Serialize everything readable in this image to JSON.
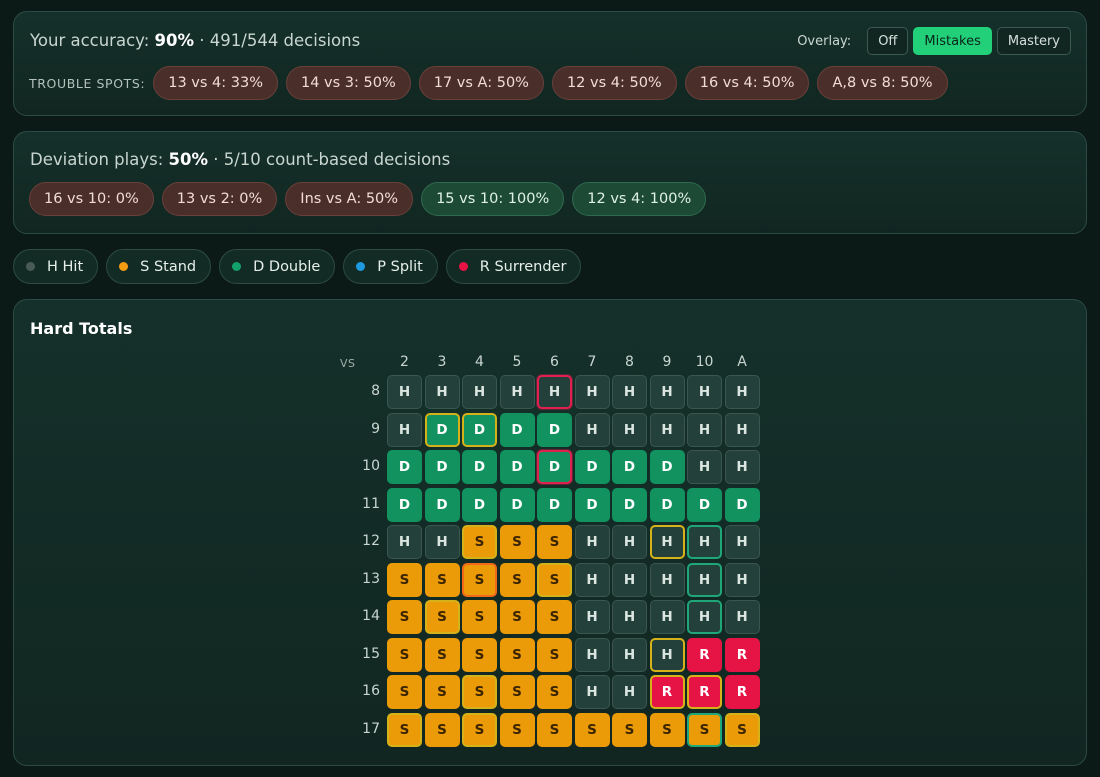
{
  "accuracy": {
    "prefix": "Your accuracy:",
    "percent": "90%",
    "detail": "· 491/544 decisions",
    "trouble_label": "TROUBLE SPOTS:",
    "trouble_spots": [
      "13 vs 4: 33%",
      "14 vs 3: 50%",
      "17 vs A: 50%",
      "12 vs 4: 50%",
      "16 vs 4: 50%",
      "A,8 vs 8: 50%"
    ]
  },
  "overlay": {
    "label": "Overlay:",
    "options": [
      "Off",
      "Mistakes",
      "Mastery"
    ],
    "selected": "Mistakes"
  },
  "deviation": {
    "prefix": "Deviation plays:",
    "percent": "50%",
    "detail": "· 5/10 count-based decisions",
    "plays": [
      {
        "label": "16 vs 10: 0%",
        "status": "bad"
      },
      {
        "label": "13 vs 2: 0%",
        "status": "bad"
      },
      {
        "label": "Ins vs A: 50%",
        "status": "bad"
      },
      {
        "label": "15 vs 10: 100%",
        "status": "good"
      },
      {
        "label": "12 vs 4: 100%",
        "status": "good"
      }
    ]
  },
  "legend": [
    {
      "label": "H Hit",
      "color": "#4a5a55"
    },
    {
      "label": "S Stand",
      "color": "#f39c12"
    },
    {
      "label": "D Double",
      "color": "#12a16b"
    },
    {
      "label": "P Split",
      "color": "#1e9ae0"
    },
    {
      "label": "R Surrender",
      "color": "#e51445"
    }
  ],
  "chart": {
    "title": "Hard Totals",
    "vs_label": "VS",
    "dealer": [
      "2",
      "3",
      "4",
      "5",
      "6",
      "7",
      "8",
      "9",
      "10",
      "A"
    ],
    "rows": [
      {
        "total": "8",
        "actions": [
          "H",
          "H",
          "H",
          "H",
          "H",
          "H",
          "H",
          "H",
          "H",
          "H"
        ]
      },
      {
        "total": "9",
        "actions": [
          "H",
          "D",
          "D",
          "D",
          "D",
          "H",
          "H",
          "H",
          "H",
          "H"
        ]
      },
      {
        "total": "10",
        "actions": [
          "D",
          "D",
          "D",
          "D",
          "D",
          "D",
          "D",
          "D",
          "H",
          "H"
        ]
      },
      {
        "total": "11",
        "actions": [
          "D",
          "D",
          "D",
          "D",
          "D",
          "D",
          "D",
          "D",
          "D",
          "D"
        ]
      },
      {
        "total": "12",
        "actions": [
          "H",
          "H",
          "S",
          "S",
          "S",
          "H",
          "H",
          "H",
          "H",
          "H"
        ]
      },
      {
        "total": "13",
        "actions": [
          "S",
          "S",
          "S",
          "S",
          "S",
          "H",
          "H",
          "H",
          "H",
          "H"
        ]
      },
      {
        "total": "14",
        "actions": [
          "S",
          "S",
          "S",
          "S",
          "S",
          "H",
          "H",
          "H",
          "H",
          "H"
        ]
      },
      {
        "total": "15",
        "actions": [
          "S",
          "S",
          "S",
          "S",
          "S",
          "H",
          "H",
          "H",
          "R",
          "R"
        ]
      },
      {
        "total": "16",
        "actions": [
          "S",
          "S",
          "S",
          "S",
          "S",
          "H",
          "H",
          "R",
          "R",
          "R"
        ]
      },
      {
        "total": "17",
        "actions": [
          "S",
          "S",
          "S",
          "S",
          "S",
          "S",
          "S",
          "S",
          "S",
          "S"
        ]
      }
    ],
    "marks": [
      {
        "row": 0,
        "col": 4,
        "type": "red"
      },
      {
        "row": 1,
        "col": 1,
        "type": "yellow"
      },
      {
        "row": 1,
        "col": 2,
        "type": "yellow"
      },
      {
        "row": 2,
        "col": 4,
        "type": "red"
      },
      {
        "row": 4,
        "col": 2,
        "type": "yellow"
      },
      {
        "row": 4,
        "col": 7,
        "type": "yellow"
      },
      {
        "row": 4,
        "col": 8,
        "type": "green"
      },
      {
        "row": 5,
        "col": 2,
        "type": "orange"
      },
      {
        "row": 5,
        "col": 4,
        "type": "yellow"
      },
      {
        "row": 5,
        "col": 8,
        "type": "green"
      },
      {
        "row": 6,
        "col": 1,
        "type": "yellow"
      },
      {
        "row": 6,
        "col": 8,
        "type": "green"
      },
      {
        "row": 7,
        "col": 7,
        "type": "yellow"
      },
      {
        "row": 8,
        "col": 2,
        "type": "yellow"
      },
      {
        "row": 8,
        "col": 7,
        "type": "yellow"
      },
      {
        "row": 8,
        "col": 8,
        "type": "yellow"
      },
      {
        "row": 9,
        "col": 0,
        "type": "yellow"
      },
      {
        "row": 9,
        "col": 2,
        "type": "yellow"
      },
      {
        "row": 9,
        "col": 8,
        "type": "green"
      },
      {
        "row": 9,
        "col": 9,
        "type": "yellow"
      }
    ]
  }
}
